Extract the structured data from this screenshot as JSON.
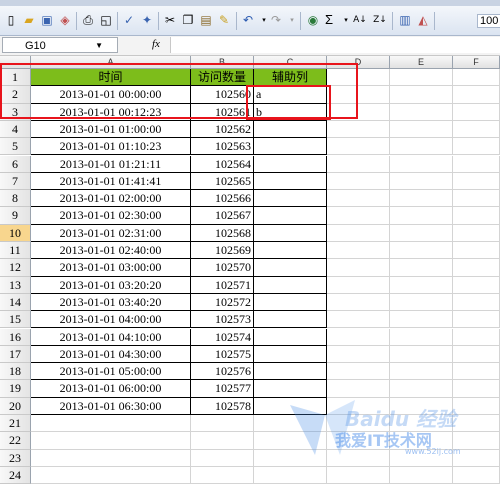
{
  "toolbar": {
    "icons": [
      "new-icon",
      "open-icon",
      "save-icon",
      "permission-icon",
      "print-icon",
      "print-preview-icon",
      "spelling-icon",
      "research-icon",
      "cut-icon",
      "copy-icon",
      "paste-icon",
      "format-painter-icon",
      "undo-icon",
      "redo-icon",
      "hyperlink-icon",
      "autosum-icon",
      "sort-ascending-icon",
      "sort-descending-icon",
      "chart-wizard-icon",
      "drawing-icon"
    ],
    "autosum_symbol": "Σ",
    "zoom_value": "100"
  },
  "formula_bar": {
    "name_box": "G10",
    "fx_label": "fx",
    "content": ""
  },
  "columns": [
    "A",
    "B",
    "C",
    "D",
    "E",
    "F"
  ],
  "active_row": "10",
  "rows": [
    {
      "num": "1",
      "a": "时间",
      "b": "访问数量",
      "c": "辅助列"
    },
    {
      "num": "2",
      "a": "2013-01-01  00:00:00",
      "b": "102560",
      "c": "a"
    },
    {
      "num": "3",
      "a": "2013-01-01  00:12:23",
      "b": "102561",
      "c": "b"
    },
    {
      "num": "4",
      "a": "2013-01-01  01:00:00",
      "b": "102562",
      "c": ""
    },
    {
      "num": "5",
      "a": "2013-01-01  01:10:23",
      "b": "102563",
      "c": ""
    },
    {
      "num": "6",
      "a": "2013-01-01  01:21:11",
      "b": "102564",
      "c": ""
    },
    {
      "num": "7",
      "a": "2013-01-01  01:41:41",
      "b": "102565",
      "c": ""
    },
    {
      "num": "8",
      "a": "2013-01-01  02:00:00",
      "b": "102566",
      "c": ""
    },
    {
      "num": "9",
      "a": "2013-01-01  02:30:00",
      "b": "102567",
      "c": ""
    },
    {
      "num": "10",
      "a": "2013-01-01  02:31:00",
      "b": "102568",
      "c": ""
    },
    {
      "num": "11",
      "a": "2013-01-01  02:40:00",
      "b": "102569",
      "c": ""
    },
    {
      "num": "12",
      "a": "2013-01-01  03:00:00",
      "b": "102570",
      "c": ""
    },
    {
      "num": "13",
      "a": "2013-01-01  03:20:20",
      "b": "102571",
      "c": ""
    },
    {
      "num": "14",
      "a": "2013-01-01  03:40:20",
      "b": "102572",
      "c": ""
    },
    {
      "num": "15",
      "a": "2013-01-01  04:00:00",
      "b": "102573",
      "c": ""
    },
    {
      "num": "16",
      "a": "2013-01-01  04:10:00",
      "b": "102574",
      "c": ""
    },
    {
      "num": "17",
      "a": "2013-01-01  04:30:00",
      "b": "102575",
      "c": ""
    },
    {
      "num": "18",
      "a": "2013-01-01  05:00:00",
      "b": "102576",
      "c": ""
    },
    {
      "num": "19",
      "a": "2013-01-01  06:00:00",
      "b": "102577",
      "c": ""
    },
    {
      "num": "20",
      "a": "2013-01-01  06:30:00",
      "b": "102578",
      "c": ""
    },
    {
      "num": "21",
      "a": "",
      "b": "",
      "c": ""
    },
    {
      "num": "22",
      "a": "",
      "b": "",
      "c": ""
    },
    {
      "num": "23",
      "a": "",
      "b": "",
      "c": ""
    },
    {
      "num": "24",
      "a": "",
      "b": "",
      "c": ""
    }
  ],
  "colors": {
    "header_fill": "#7dbd1b",
    "highlight_red": "#e8141c",
    "active_row_header": "#f8d68e"
  },
  "watermark": {
    "text1": "Baidu 经验",
    "text2": "我爱IT技术网",
    "url": "www.52ij.com"
  }
}
